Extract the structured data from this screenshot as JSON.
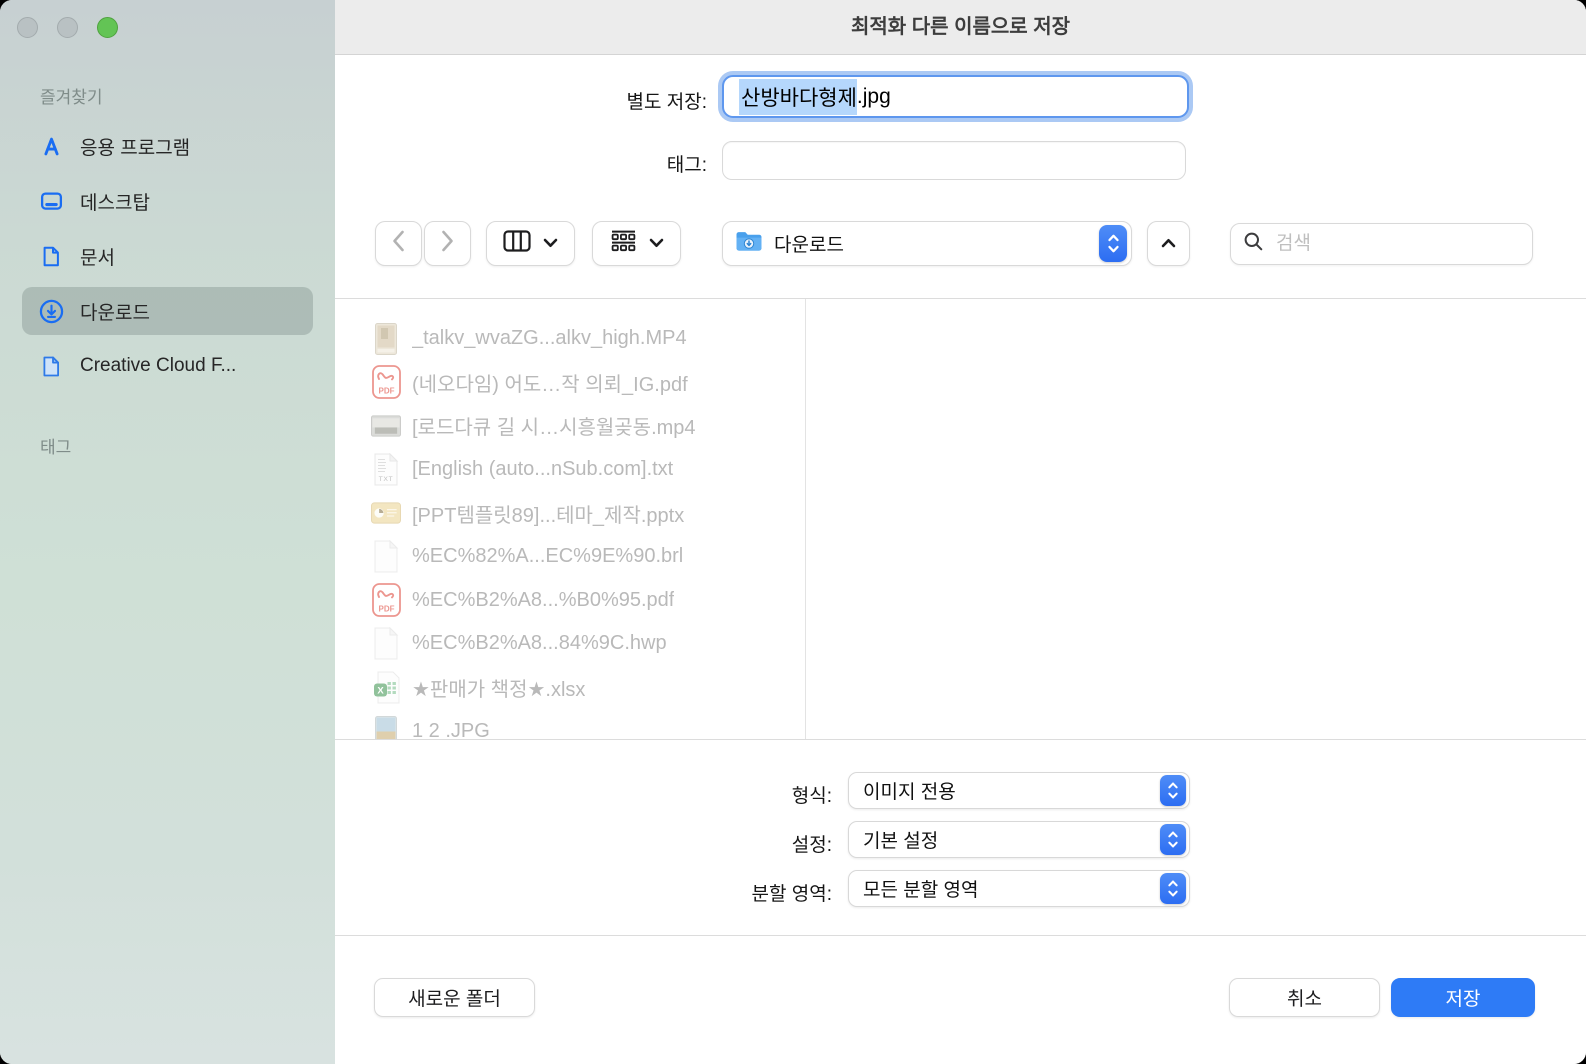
{
  "window": {
    "title": "최적화 다른 이름으로 저장"
  },
  "traffic_lights": {
    "close": "disabled-gray",
    "minimize": "disabled-gray",
    "zoom": "green"
  },
  "sidebar": {
    "favorites_header": "즐겨찾기",
    "items": [
      {
        "id": "applications",
        "label": "응용 프로그램",
        "icon": "appstore-icon",
        "selected": false
      },
      {
        "id": "desktop",
        "label": "데스크탑",
        "icon": "desktop-icon",
        "selected": false
      },
      {
        "id": "documents",
        "label": "문서",
        "icon": "document-icon",
        "selected": false
      },
      {
        "id": "downloads",
        "label": "다운로드",
        "icon": "downloads-icon",
        "selected": true
      },
      {
        "id": "creative-cloud",
        "label": "Creative Cloud F...",
        "icon": "creative-cloud-file-icon",
        "selected": false
      }
    ],
    "tags_header": "태그"
  },
  "form": {
    "save_as_label": "별도 저장:",
    "filename_selected": "산방바다형제",
    "filename_extension": ".jpg",
    "tags_label": "태그:",
    "tags_value": ""
  },
  "toolbar": {
    "path_folder": "다운로드",
    "path_folder_icon": "downloads-folder-icon",
    "search_placeholder": "검색"
  },
  "file_list": [
    {
      "name": "_talkv_wvaZG...alkv_high.MP4",
      "icon": "video-portrait-thumbnail-icon"
    },
    {
      "name": "(네오다임) 어도…작 의뢰_IG.pdf",
      "icon": "pdf-file-icon"
    },
    {
      "name": "[로드다큐 길 시…시흥월곶동.mp4",
      "icon": "video-landscape-thumbnail-icon"
    },
    {
      "name": "[English (auto...nSub.com].txt",
      "icon": "txt-file-icon"
    },
    {
      "name": "[PPT템플릿89]...테마_제작.pptx",
      "icon": "pptx-file-icon"
    },
    {
      "name": "%EC%82%A...EC%9E%90.brl",
      "icon": "generic-file-icon"
    },
    {
      "name": "%EC%B2%A8...%B0%95.pdf",
      "icon": "pdf-file-icon"
    },
    {
      "name": "%EC%B2%A8...84%9C.hwp",
      "icon": "generic-file-icon"
    },
    {
      "name": "★판매가 책정★.xlsx",
      "icon": "xlsx-file-icon"
    },
    {
      "name": "1 2 .JPG",
      "icon": "jpg-thumbnail-icon"
    }
  ],
  "options": {
    "rows": [
      {
        "id": "format",
        "label": "형식:",
        "value": "이미지 전용"
      },
      {
        "id": "settings",
        "label": "설정:",
        "value": "기본 설정"
      },
      {
        "id": "split-area",
        "label": "분할 영역:",
        "value": "모든 분할 영역"
      }
    ]
  },
  "footer": {
    "new_folder_label": "새로운 폴더",
    "cancel_label": "취소",
    "save_label": "저장"
  },
  "colors": {
    "accent_blue": "#2e7bf6",
    "text_selection": "#b5d7fc",
    "focus_ring": "#abc9f4",
    "sidebar_selected": "rgba(108,125,120,0.32)",
    "disabled_text": "#b9b9b9"
  }
}
